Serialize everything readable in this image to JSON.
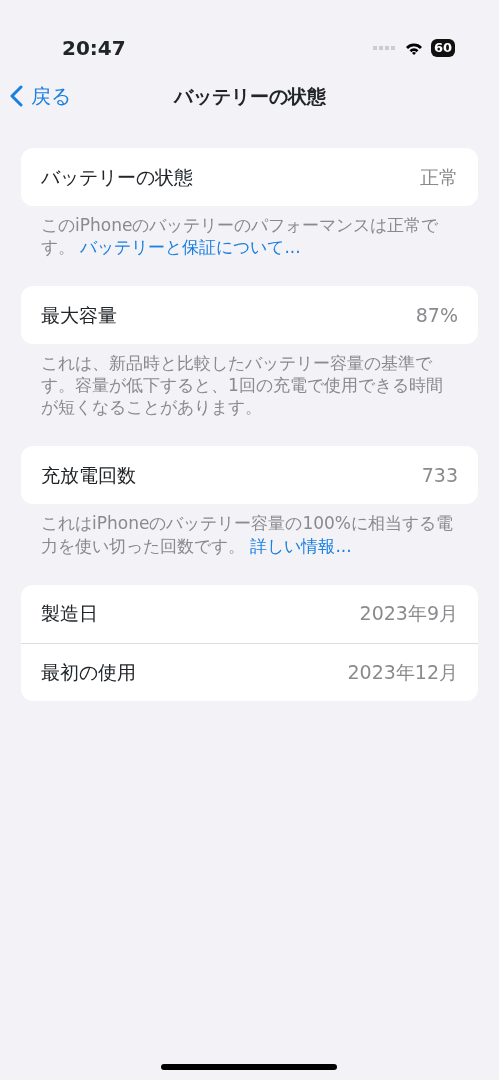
{
  "status_bar": {
    "time": "20:47",
    "battery": "60"
  },
  "nav": {
    "back": "戻る",
    "title": "バッテリーの状態"
  },
  "sections": [
    {
      "rows": [
        {
          "label": "バッテリーの状態",
          "value": "正常"
        }
      ],
      "footer": {
        "text": "このiPhoneのバッテリーのパフォーマンスは正常です。",
        "link": "バッテリーと保証について..."
      }
    },
    {
      "rows": [
        {
          "label": "最大容量",
          "value": "87%"
        }
      ],
      "footer": {
        "text": "これは、新品時と比較したバッテリー容量の基準です。容量が低下すると、1回の充電で使用できる時間が短くなることがあります。"
      }
    },
    {
      "rows": [
        {
          "label": "充放電回数",
          "value": "733"
        }
      ],
      "footer": {
        "text": "これはiPhoneのバッテリー容量の100%に相当する電力を使い切った回数です。",
        "link": "詳しい情報..."
      }
    },
    {
      "rows": [
        {
          "label": "製造日",
          "value": "2023年9月"
        },
        {
          "label": "最初の使用",
          "value": "2023年12月"
        }
      ]
    }
  ]
}
